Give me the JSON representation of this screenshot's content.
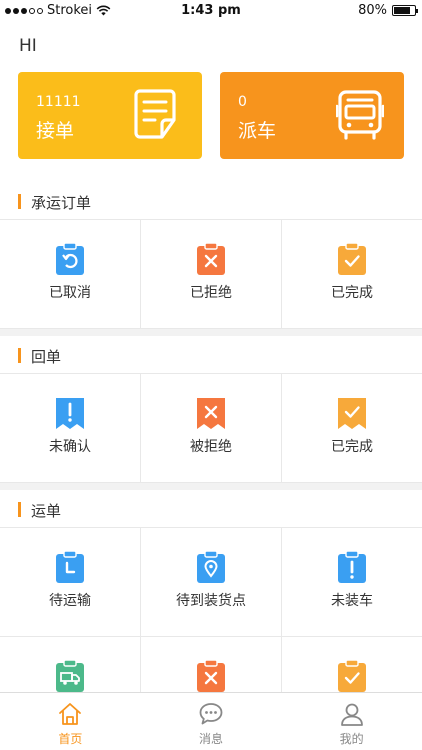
{
  "status_bar": {
    "carrier": "Strokei",
    "time": "1:43 pm",
    "battery": "80%",
    "battery_level": 0.8
  },
  "greeting": "HI",
  "cards": {
    "orders": {
      "count": "11111",
      "label": "接单",
      "icon": "document-icon",
      "color": "#fbbd1a"
    },
    "dispatch": {
      "count": "0",
      "label": "派车",
      "icon": "bus-icon",
      "color": "#f7941d"
    }
  },
  "sections": {
    "carrier_orders": {
      "title": "承运订单",
      "items": [
        {
          "label": "已取消",
          "icon": "undo-clipboard-icon",
          "color": "#3a9ff2"
        },
        {
          "label": "已拒绝",
          "icon": "x-clipboard-icon",
          "color": "#f5773f"
        },
        {
          "label": "已完成",
          "icon": "check-clipboard-icon",
          "color": "#f7a93a"
        }
      ]
    },
    "receipts": {
      "title": "回单",
      "items": [
        {
          "label": "未确认",
          "icon": "exclamation-receipt-icon",
          "color": "#3a9ff2"
        },
        {
          "label": "被拒绝",
          "icon": "x-receipt-icon",
          "color": "#f5773f"
        },
        {
          "label": "已完成",
          "icon": "check-receipt-icon",
          "color": "#f7a93a"
        }
      ]
    },
    "waybills": {
      "title": "运单",
      "items": [
        {
          "label": "待运输",
          "icon": "clock-clipboard-icon",
          "color": "#3a9ff2"
        },
        {
          "label": "待到装货点",
          "icon": "location-clipboard-icon",
          "color": "#3a9ff2"
        },
        {
          "label": "未装车",
          "icon": "exclamation-clipboard-icon",
          "color": "#3a9ff2"
        },
        {
          "label": "",
          "icon": "truck-clipboard-icon",
          "color": "#4cb98a"
        },
        {
          "label": "",
          "icon": "x-clipboard-icon",
          "color": "#f5773f"
        },
        {
          "label": "",
          "icon": "check-clipboard-icon",
          "color": "#f7a93a"
        }
      ]
    }
  },
  "tab_bar": {
    "tabs": [
      {
        "label": "首页",
        "icon": "home-icon"
      },
      {
        "label": "消息",
        "icon": "chat-icon"
      },
      {
        "label": "我的",
        "icon": "user-icon"
      }
    ],
    "active_color": "#f7941d"
  }
}
